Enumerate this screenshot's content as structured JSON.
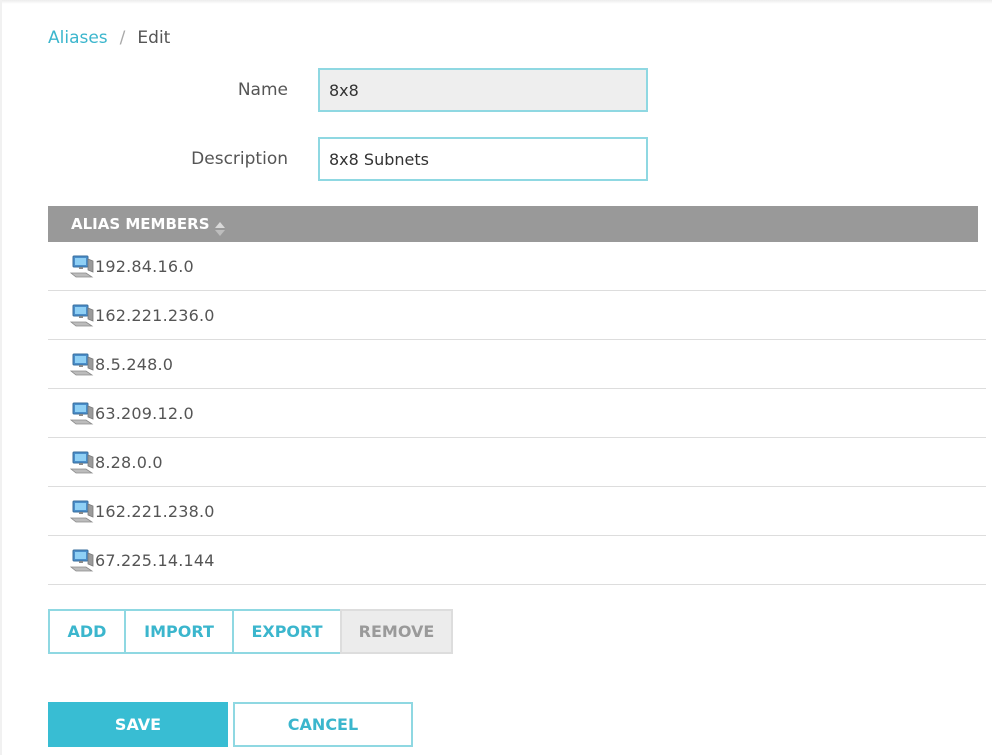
{
  "breadcrumb": {
    "parent": "Aliases",
    "separator": "/",
    "current": "Edit"
  },
  "form": {
    "name_label": "Name",
    "name_value": "8x8",
    "description_label": "Description",
    "description_value": "8x8 Subnets"
  },
  "members": {
    "header": "ALIAS MEMBERS",
    "icon": "computer-icon",
    "items": [
      "192.84.16.0",
      "162.221.236.0",
      "8.5.248.0",
      "63.209.12.0",
      "8.28.0.0",
      "162.221.238.0",
      "67.225.14.144"
    ]
  },
  "actions": {
    "add": "ADD",
    "import": "IMPORT",
    "export": "EXPORT",
    "remove": "REMOVE"
  },
  "footer": {
    "save": "SAVE",
    "cancel": "CANCEL"
  },
  "colors": {
    "accent": "#38bdd3",
    "link": "#3bb6cd",
    "border": "#8fd8e2",
    "header_bg": "#999999",
    "disabled_bg": "#ececec"
  }
}
